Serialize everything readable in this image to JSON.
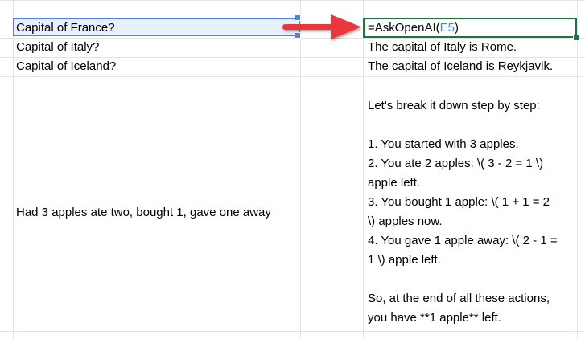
{
  "cells": {
    "a1": "Capital of France?",
    "a2": "Capital of Italy?",
    "a3": "Capital of Iceland?",
    "a5": "Had 3 apples ate two, bought 1, gave one away",
    "formula_prefix": "=AskOpenAI(",
    "formula_ref": "E5",
    "formula_suffix": ")",
    "b2": "The capital of Italy is Rome.",
    "b3": "The capital of Iceland is Reykjavik.",
    "b5_lines": [
      "Let's break it down step by step:",
      "",
      "1. You started with 3 apples.",
      "2. You ate 2 apples: \\( 3 - 2 = 1 \\)",
      "apple left.",
      "3. You bought 1 apple: \\( 1 + 1 = 2",
      "\\) apples now.",
      "4. You gave 1 apple away: \\( 2 - 1 =",
      "1 \\) apple left.",
      "",
      "So, at the end of all these actions,",
      "you have **1 apple** left."
    ]
  },
  "annotation": {
    "arrow_color": "#e8383d"
  },
  "colors": {
    "selection_border": "#4a86e8",
    "active_border": "#1e7145",
    "grid": "#e2e3e3"
  }
}
